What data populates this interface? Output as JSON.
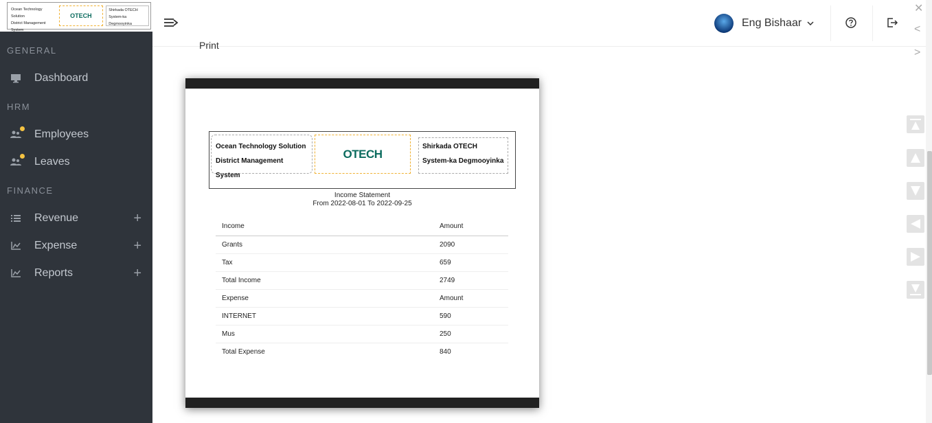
{
  "brand": {
    "mini_left_line1": "Ocean Technology Solution",
    "mini_left_line2": "District Management System",
    "mini_logo": "OTECH",
    "mini_right_line1": "Shirkada OTECH",
    "mini_right_line2": "System-ka Degmooyinka"
  },
  "sidebar": {
    "sections": [
      "GENERAL",
      "HRM",
      "FINANCE"
    ],
    "items": [
      {
        "label": "Dashboard",
        "icon": "monitor-icon"
      },
      {
        "label": "Employees",
        "icon": "users-icon",
        "badge_color": "#f5c342"
      },
      {
        "label": "Leaves",
        "icon": "users-icon",
        "badge_color": "#f5c342"
      },
      {
        "label": "Revenue",
        "icon": "list-icon",
        "expand": "+"
      },
      {
        "label": "Expense",
        "icon": "chart-icon",
        "expand": "+"
      },
      {
        "label": "Reports",
        "icon": "chart-icon",
        "expand": "+"
      }
    ]
  },
  "topbar": {
    "user_name": "Eng Bishaar",
    "print_label": "Print"
  },
  "document": {
    "header_left_line1": "Ocean Technology Solution",
    "header_left_line2": "District Management System",
    "logo": "OTECH",
    "header_right_line1": "Shirkada OTECH",
    "header_right_line2": "System-ka Degmooyinka",
    "title": "Income Statement",
    "period": "From 2022-08-01 To 2022-09-25",
    "rows": [
      {
        "label": "Income",
        "amount": "Amount",
        "head": true
      },
      {
        "label": "Grants",
        "amount": "2090"
      },
      {
        "label": "Tax",
        "amount": "659"
      },
      {
        "label": "Total Income",
        "amount": "2749"
      },
      {
        "label": "Expense",
        "amount": "Amount"
      },
      {
        "label": "INTERNET",
        "amount": "590"
      },
      {
        "label": "Mus",
        "amount": "250"
      },
      {
        "label": "Total Expense",
        "amount": "840"
      }
    ]
  },
  "colors": {
    "sidebar_bg": "#2f343b",
    "accent_dot": "#f5c342",
    "logo_green": "#0b6b5e",
    "doc_bar": "#212121"
  },
  "viewer": {
    "close_glyph": "✕",
    "prev_glyph": "<",
    "next_glyph": ">"
  }
}
